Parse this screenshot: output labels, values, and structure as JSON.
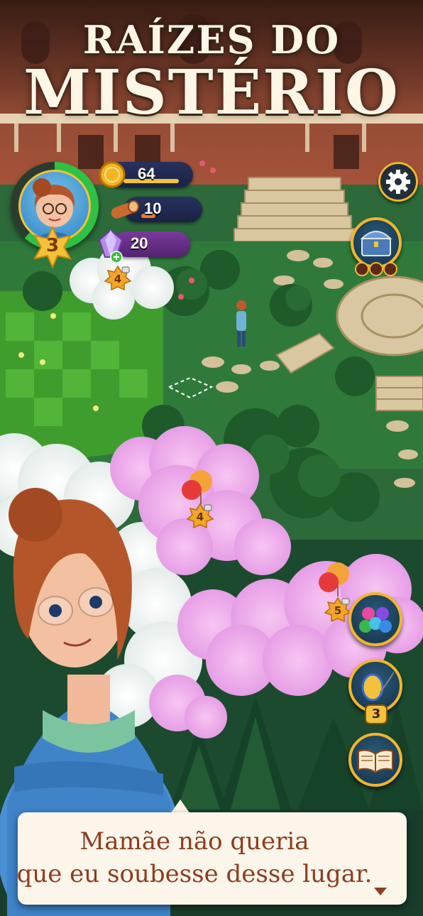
{
  "title": {
    "line1": "RAÍZES DO",
    "line2": "MISTÉRIO"
  },
  "player": {
    "level": "3"
  },
  "resources": {
    "coins": {
      "value": "64",
      "icon": "coin-icon"
    },
    "wood": {
      "value": "10",
      "icon": "wood-log-icon"
    },
    "gems": {
      "value": "20",
      "icon": "crystal-gem-icon"
    }
  },
  "locks": [
    {
      "id": "fog-lock-1",
      "level": "4"
    },
    {
      "id": "fog-lock-2",
      "level": "4"
    },
    {
      "id": "fog-lock-3",
      "level": "5"
    }
  ],
  "side_buttons": {
    "settings": {
      "icon": "gear-icon"
    },
    "chest": {
      "icon": "treasure-chest-icon"
    },
    "puzzle": {
      "icon": "match-pieces-icon"
    },
    "egg": {
      "icon": "egg-quill-icon",
      "count": "3"
    },
    "journal": {
      "icon": "open-book-icon"
    }
  },
  "dialog": {
    "line1": "Mamãe não queria",
    "line2": "que eu soubesse desse lugar."
  },
  "colors": {
    "title_text": "#fdf6e6",
    "dialog_text": "#8c3d1e",
    "button_rim": "#f2b52c",
    "level_star": "#f3c23a"
  }
}
